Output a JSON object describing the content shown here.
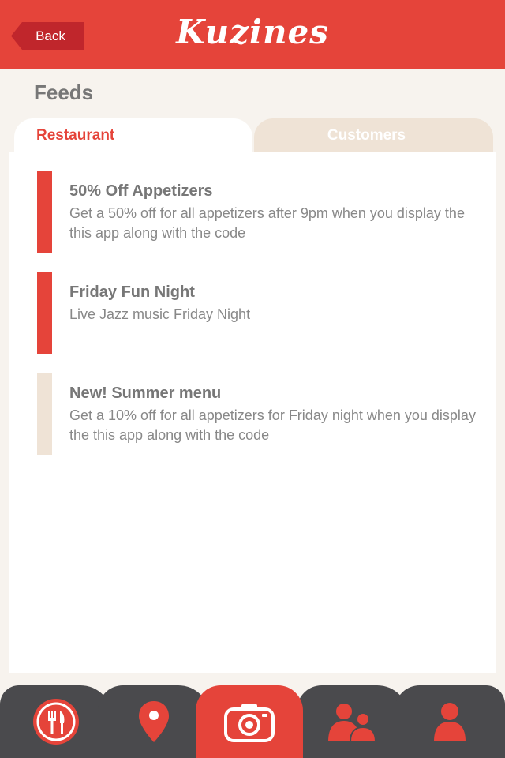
{
  "header": {
    "back_label": "Back",
    "brand": "Kuzines"
  },
  "page": {
    "title": "Feeds"
  },
  "tabs": [
    {
      "label": "Restaurant",
      "active": true
    },
    {
      "label": "Customers",
      "active": false
    }
  ],
  "feeds": [
    {
      "title": "50% Off Appetizers",
      "body": "Get a 50% off for all appetizers after 9pm when you display the this app along with the code",
      "marker_color": "#e5443a"
    },
    {
      "title": "Friday Fun Night",
      "body": "Live Jazz music Friday Night",
      "marker_color": "#e5443a"
    },
    {
      "title": "New! Summer menu",
      "body": "Get a 10% off for all appetizers for Friday night when you display the this app along with the code",
      "marker_color": "#efe3d6"
    }
  ],
  "tabbar": {
    "items": [
      {
        "icon": "restaurant-icon"
      },
      {
        "icon": "location-pin-icon"
      },
      {
        "icon": "camera-icon",
        "active": true
      },
      {
        "icon": "friends-icon"
      },
      {
        "icon": "profile-icon"
      }
    ]
  },
  "colors": {
    "accent": "#e5443a",
    "accent_dark": "#c0262c",
    "background": "#f7f3ee",
    "inactive_tab": "#efe3d6",
    "tabbar": "#4a4a4d"
  }
}
